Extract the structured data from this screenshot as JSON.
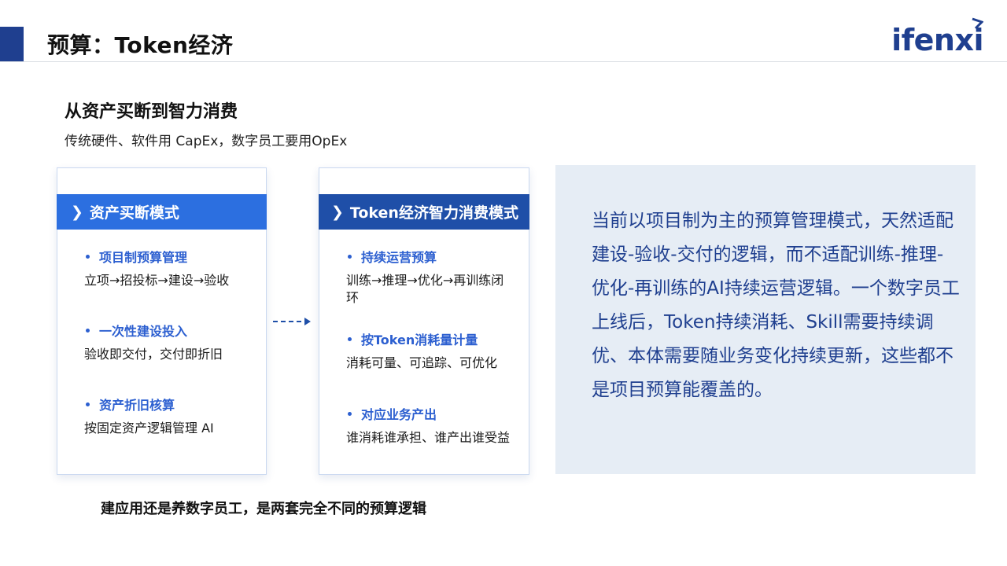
{
  "header": {
    "title": "预算：Token经济",
    "logo_text": "ifenxi",
    "accent_color": "#1f3f8f"
  },
  "section": {
    "title": "从资产买断到智力消费",
    "subtitle": "传统硬件、软件用 CapEx，数字员工要用OpEx"
  },
  "left_card": {
    "header": "资产买断模式",
    "header_color": "#2c6fe0",
    "items": [
      {
        "title": "项目制预算管理",
        "text": "立项→招投标→建设→验收"
      },
      {
        "title": "一次性建设投入",
        "text": "验收即交付，交付即折旧"
      },
      {
        "title": "资产折旧核算",
        "text": "按固定资产逻辑管理 AI"
      }
    ]
  },
  "right_card": {
    "header": "Token经济智力消费模式",
    "header_color": "#1f4fa8",
    "items": [
      {
        "title": "持续运营预算",
        "text": "训练→推理→优化→再训练闭环"
      },
      {
        "title": "按Token消耗量计量",
        "text": "消耗可量、可追踪、可优化"
      },
      {
        "title": "对应业务产出",
        "text": "谁消耗谁承担、谁产出谁受益"
      }
    ]
  },
  "panel": {
    "text": "当前以项目制为主的预算管理模式，天然适配建设-验收-交付的逻辑，而不适配训练-推理-优化-再训练的AI持续运营逻辑。一个数字员工上线后，Token持续消耗、Skill需要持续调优、本体需要随业务变化持续更新，这些都不是项目预算能覆盖的。",
    "background": "#e6edf5",
    "text_color": "#1f3f8f"
  },
  "footer": {
    "note": "建应用还是养数字员工，是两套完全不同的预算逻辑"
  }
}
